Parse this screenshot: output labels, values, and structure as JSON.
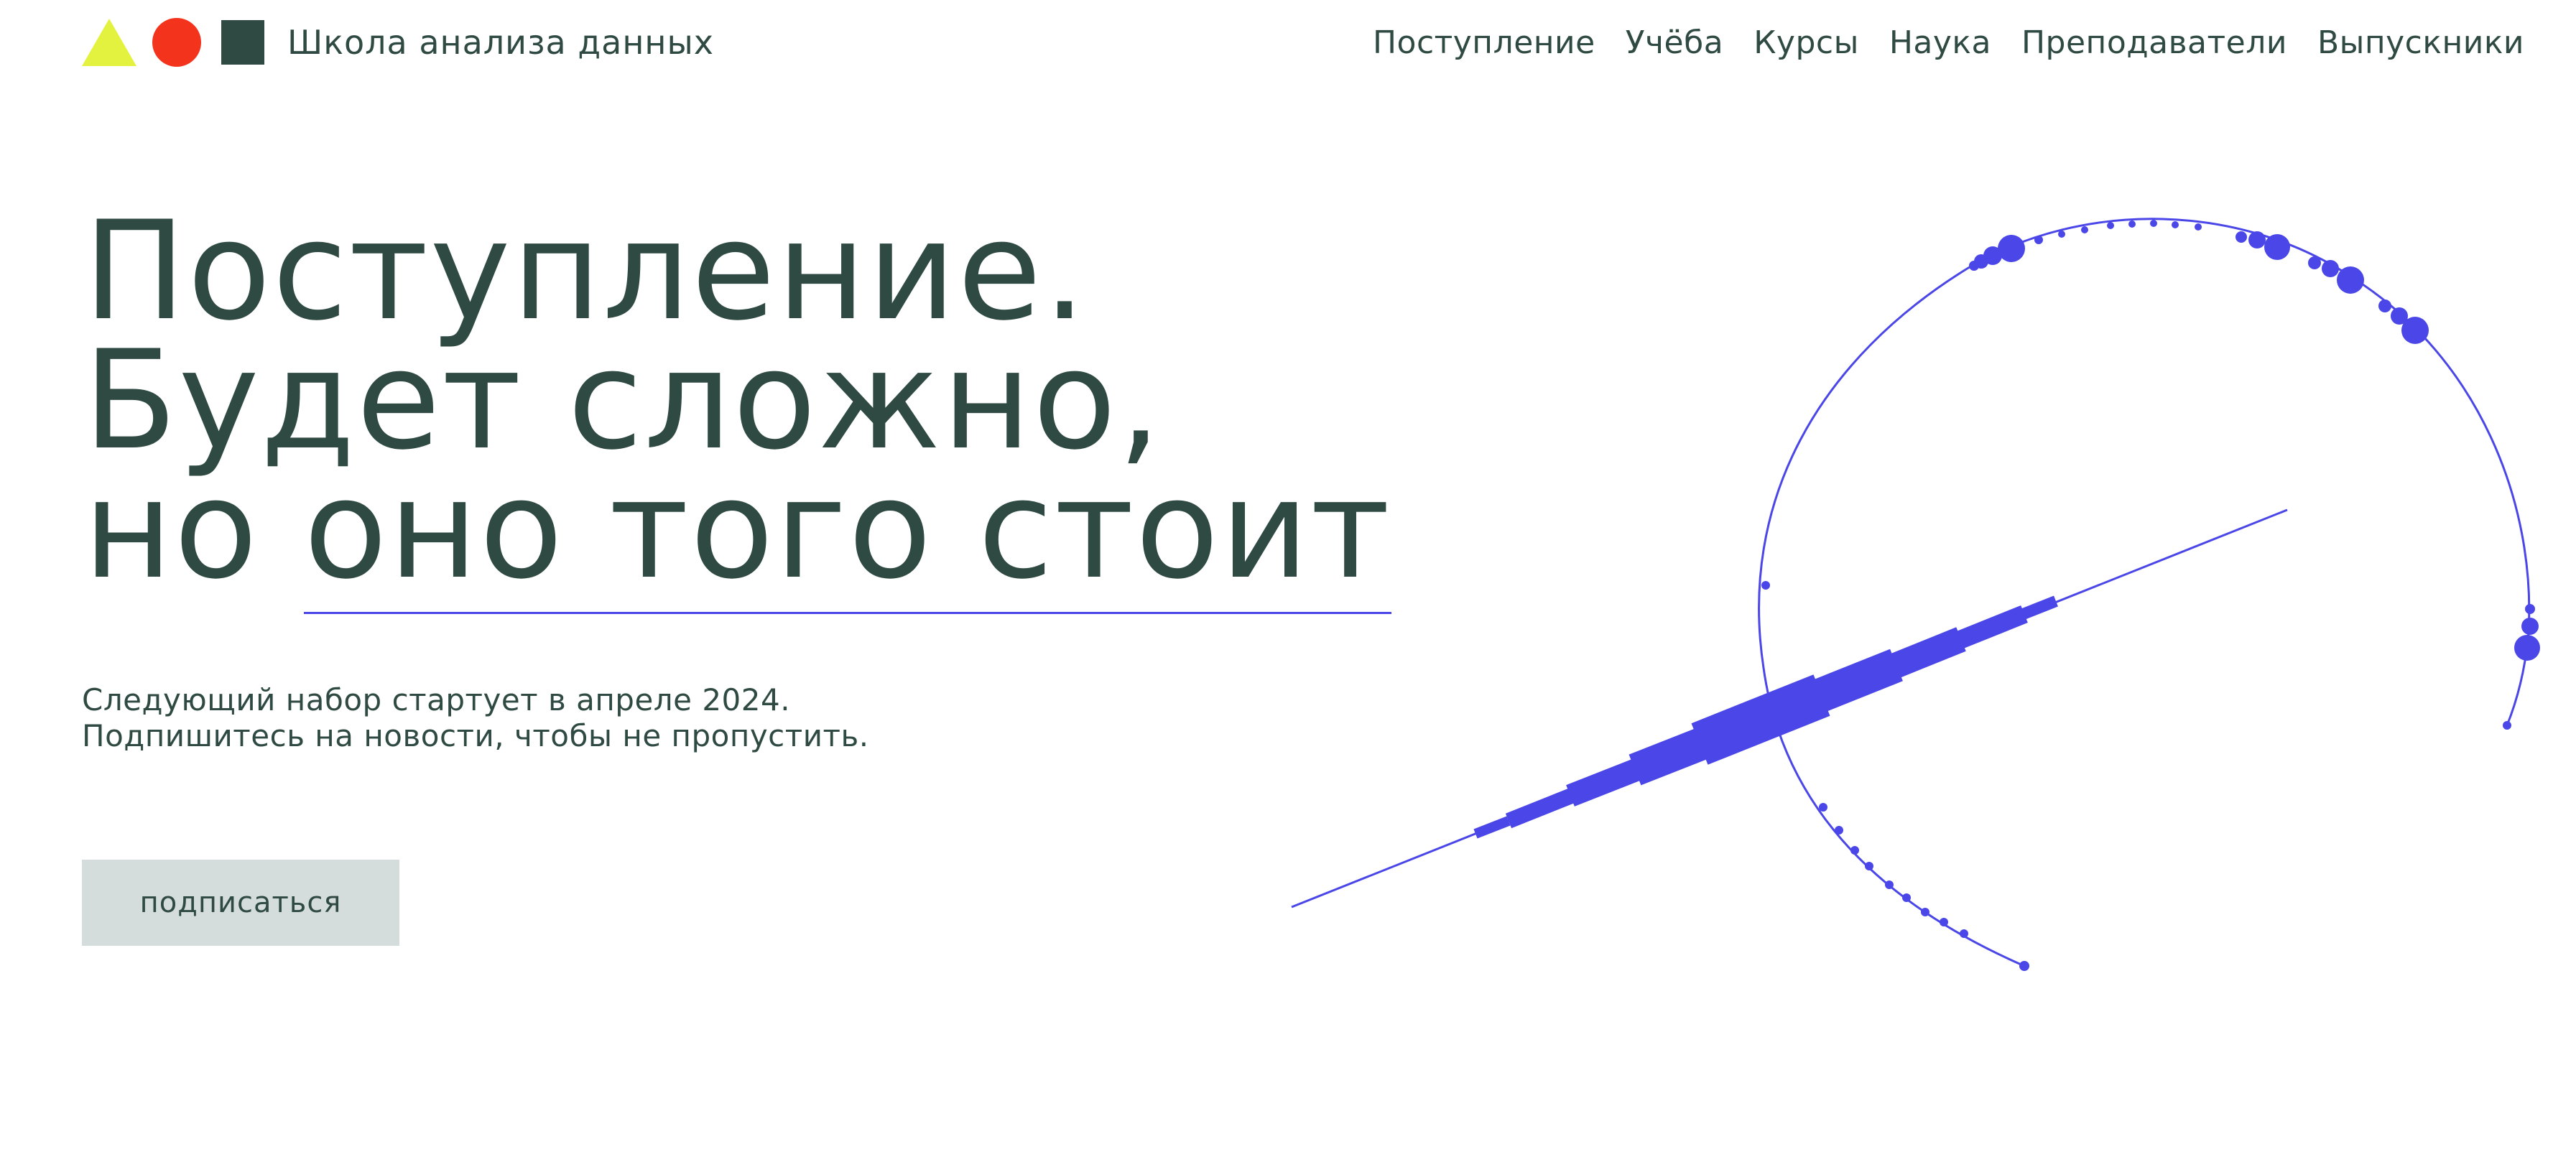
{
  "header": {
    "logo_text": "Школа анализа данных",
    "nav": [
      {
        "label": "Поступление"
      },
      {
        "label": "Учёба"
      },
      {
        "label": "Курсы"
      },
      {
        "label": "Наука"
      },
      {
        "label": "Преподаватели"
      },
      {
        "label": "Выпускники"
      }
    ]
  },
  "hero": {
    "line1": "Поступление.",
    "line2": "Будет сложно,",
    "line3_prefix": "но ",
    "line3_underlined": "оно того стоит",
    "subtitle_line1": "Следующий набор стартует в апреле 2024.",
    "subtitle_line2": "Подпишитесь на новости, чтобы не пропустить.",
    "button_label": "подписаться"
  },
  "colors": {
    "text": "#2f4a42",
    "accent": "#4a46e8",
    "logo_yellow": "#e3f23f",
    "logo_red": "#f4331c",
    "button_bg": "#d4dcdc"
  }
}
